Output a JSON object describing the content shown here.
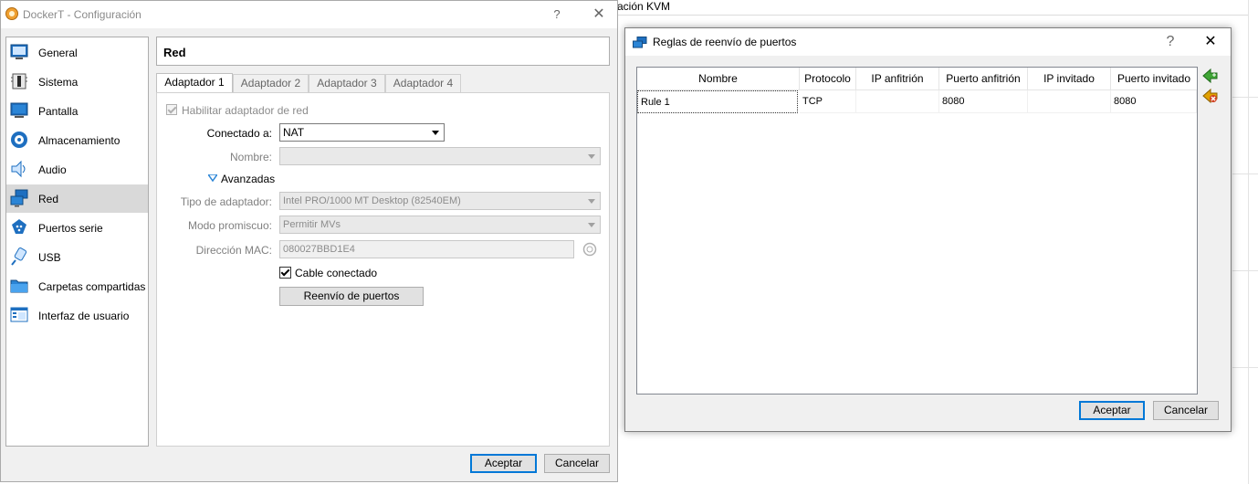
{
  "background": {
    "fragment_text": "ación KVM"
  },
  "main_dialog": {
    "title": "DockerT - Configuración",
    "help": "?",
    "close": "✕",
    "categories": [
      {
        "label": "General",
        "icon": "general-icon"
      },
      {
        "label": "Sistema",
        "icon": "system-icon"
      },
      {
        "label": "Pantalla",
        "icon": "display-icon"
      },
      {
        "label": "Almacenamiento",
        "icon": "storage-icon"
      },
      {
        "label": "Audio",
        "icon": "audio-icon"
      },
      {
        "label": "Red",
        "icon": "network-icon",
        "selected": true
      },
      {
        "label": "Puertos serie",
        "icon": "serial-ports-icon"
      },
      {
        "label": "USB",
        "icon": "usb-icon"
      },
      {
        "label": "Carpetas compartidas",
        "icon": "shared-folders-icon"
      },
      {
        "label": "Interfaz de usuario",
        "icon": "user-interface-icon"
      }
    ],
    "section_title": "Red",
    "tabs": [
      "Adaptador 1",
      "Adaptador 2",
      "Adaptador 3",
      "Adaptador 4"
    ],
    "active_tab": 0,
    "enable_adapter_label": "Habilitar adaptador de red",
    "enable_adapter_checked": true,
    "attached_to_label": "Conectado a:",
    "attached_to_value": "NAT",
    "name_label": "Nombre:",
    "name_value": "",
    "advanced_label": "Avanzadas",
    "adapter_type_label": "Tipo de adaptador:",
    "adapter_type_value": "Intel PRO/1000 MT Desktop (82540EM)",
    "promiscuous_label": "Modo promiscuo:",
    "promiscuous_value": "Permitir MVs",
    "mac_label": "Dirección MAC:",
    "mac_value": "080027BBD1E4",
    "cable_label": "Cable conectado",
    "cable_checked": true,
    "port_forwarding_button": "Reenvío de puertos",
    "ok_button": "Aceptar",
    "cancel_button": "Cancelar"
  },
  "pf_dialog": {
    "title": "Reglas de reenvío de puertos",
    "help": "?",
    "close": "✕",
    "columns": [
      "Nombre",
      "Protocolo",
      "IP anfitrión",
      "Puerto anfitrión",
      "IP invitado",
      "Puerto invitado"
    ],
    "rows": [
      [
        "Rule 1",
        "TCP",
        "",
        "8080",
        "",
        "8080"
      ]
    ],
    "ok_button": "Aceptar",
    "cancel_button": "Cancelar",
    "colors": {
      "accent": "#0078d7",
      "add_icon": "#3fa535",
      "remove_icon": "#d04020"
    }
  }
}
